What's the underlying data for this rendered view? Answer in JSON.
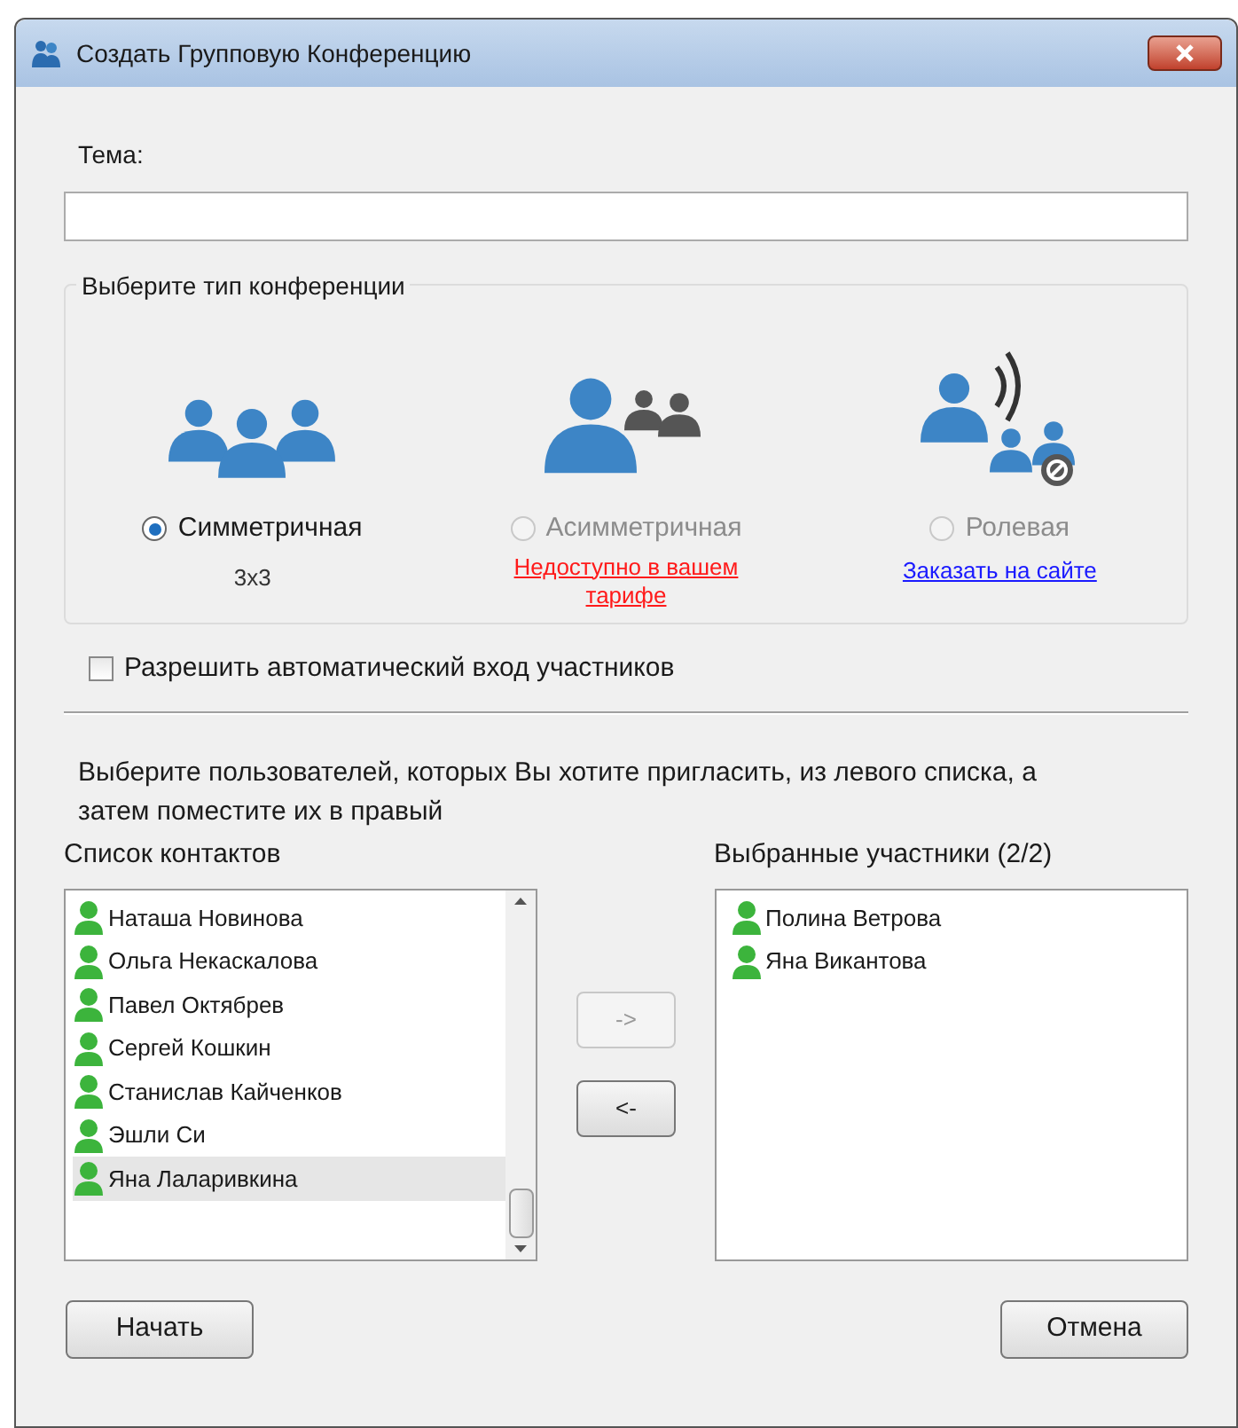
{
  "window": {
    "title": "Создать Групповую Конференцию"
  },
  "topic": {
    "label": "Тема:"
  },
  "conference_type": {
    "title": "Выберите тип конференции",
    "options": [
      {
        "kind": "group",
        "label": "Симметричная",
        "selected": true,
        "disabled": false,
        "note": {
          "kind": "text",
          "text": "3x3"
        }
      },
      {
        "kind": "presenter",
        "label": "Асимметричная",
        "selected": false,
        "disabled": true,
        "note": {
          "kind": "warning",
          "text": "Недоступно в вашем тарифе"
        }
      },
      {
        "kind": "speaker",
        "label": "Ролевая",
        "selected": false,
        "disabled": true,
        "note": {
          "kind": "link",
          "text": "Заказать на сайте"
        }
      }
    ]
  },
  "auto_join": {
    "label": "Разрешить автоматический вход участников",
    "checked": false
  },
  "instructions": "Выберите пользователей, которых Вы хотите пригласить, из левого списка, а затем поместите их в правый",
  "contacts": {
    "title": "Список контактов",
    "items": [
      {
        "name": "Наташа Новинова",
        "selected": false
      },
      {
        "name": "Ольга Некаскалова",
        "selected": false
      },
      {
        "name": "Павел Октябрев",
        "selected": false
      },
      {
        "name": "Сергей Кошкин",
        "selected": false
      },
      {
        "name": "Станислав Кайченков",
        "selected": false
      },
      {
        "name": "Эшли Си",
        "selected": false
      },
      {
        "name": "Яна Лаларивкина",
        "selected": true
      }
    ]
  },
  "move_buttons": [
    {
      "label": "->",
      "disabled": true
    },
    {
      "label": "<-",
      "disabled": false
    }
  ],
  "participants": {
    "title": "Выбранные участники (2/2)",
    "items": [
      {
        "name": "Полина Ветрова"
      },
      {
        "name": "Яна Викантова"
      }
    ]
  },
  "buttons": [
    {
      "label": "Начать"
    },
    {
      "label": "Отмена"
    }
  ]
}
